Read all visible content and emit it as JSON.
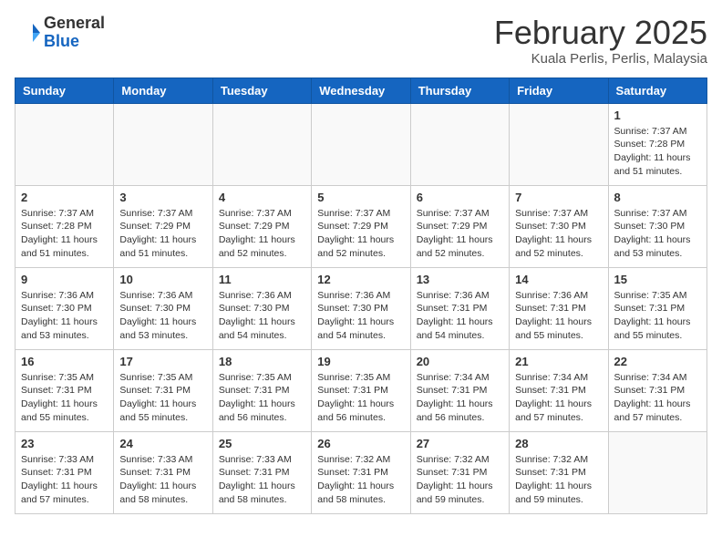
{
  "header": {
    "logo_general": "General",
    "logo_blue": "Blue",
    "month_year": "February 2025",
    "location": "Kuala Perlis, Perlis, Malaysia"
  },
  "weekdays": [
    "Sunday",
    "Monday",
    "Tuesday",
    "Wednesday",
    "Thursday",
    "Friday",
    "Saturday"
  ],
  "weeks": [
    [
      {
        "day": "",
        "sunrise": "",
        "sunset": "",
        "daylight": "",
        "empty": true
      },
      {
        "day": "",
        "sunrise": "",
        "sunset": "",
        "daylight": "",
        "empty": true
      },
      {
        "day": "",
        "sunrise": "",
        "sunset": "",
        "daylight": "",
        "empty": true
      },
      {
        "day": "",
        "sunrise": "",
        "sunset": "",
        "daylight": "",
        "empty": true
      },
      {
        "day": "",
        "sunrise": "",
        "sunset": "",
        "daylight": "",
        "empty": true
      },
      {
        "day": "",
        "sunrise": "",
        "sunset": "",
        "daylight": "",
        "empty": true
      },
      {
        "day": "1",
        "sunrise": "Sunrise: 7:37 AM",
        "sunset": "Sunset: 7:28 PM",
        "daylight": "Daylight: 11 hours and 51 minutes.",
        "empty": false
      }
    ],
    [
      {
        "day": "2",
        "sunrise": "Sunrise: 7:37 AM",
        "sunset": "Sunset: 7:28 PM",
        "daylight": "Daylight: 11 hours and 51 minutes.",
        "empty": false
      },
      {
        "day": "3",
        "sunrise": "Sunrise: 7:37 AM",
        "sunset": "Sunset: 7:29 PM",
        "daylight": "Daylight: 11 hours and 51 minutes.",
        "empty": false
      },
      {
        "day": "4",
        "sunrise": "Sunrise: 7:37 AM",
        "sunset": "Sunset: 7:29 PM",
        "daylight": "Daylight: 11 hours and 52 minutes.",
        "empty": false
      },
      {
        "day": "5",
        "sunrise": "Sunrise: 7:37 AM",
        "sunset": "Sunset: 7:29 PM",
        "daylight": "Daylight: 11 hours and 52 minutes.",
        "empty": false
      },
      {
        "day": "6",
        "sunrise": "Sunrise: 7:37 AM",
        "sunset": "Sunset: 7:29 PM",
        "daylight": "Daylight: 11 hours and 52 minutes.",
        "empty": false
      },
      {
        "day": "7",
        "sunrise": "Sunrise: 7:37 AM",
        "sunset": "Sunset: 7:30 PM",
        "daylight": "Daylight: 11 hours and 52 minutes.",
        "empty": false
      },
      {
        "day": "8",
        "sunrise": "Sunrise: 7:37 AM",
        "sunset": "Sunset: 7:30 PM",
        "daylight": "Daylight: 11 hours and 53 minutes.",
        "empty": false
      }
    ],
    [
      {
        "day": "9",
        "sunrise": "Sunrise: 7:36 AM",
        "sunset": "Sunset: 7:30 PM",
        "daylight": "Daylight: 11 hours and 53 minutes.",
        "empty": false
      },
      {
        "day": "10",
        "sunrise": "Sunrise: 7:36 AM",
        "sunset": "Sunset: 7:30 PM",
        "daylight": "Daylight: 11 hours and 53 minutes.",
        "empty": false
      },
      {
        "day": "11",
        "sunrise": "Sunrise: 7:36 AM",
        "sunset": "Sunset: 7:30 PM",
        "daylight": "Daylight: 11 hours and 54 minutes.",
        "empty": false
      },
      {
        "day": "12",
        "sunrise": "Sunrise: 7:36 AM",
        "sunset": "Sunset: 7:30 PM",
        "daylight": "Daylight: 11 hours and 54 minutes.",
        "empty": false
      },
      {
        "day": "13",
        "sunrise": "Sunrise: 7:36 AM",
        "sunset": "Sunset: 7:31 PM",
        "daylight": "Daylight: 11 hours and 54 minutes.",
        "empty": false
      },
      {
        "day": "14",
        "sunrise": "Sunrise: 7:36 AM",
        "sunset": "Sunset: 7:31 PM",
        "daylight": "Daylight: 11 hours and 55 minutes.",
        "empty": false
      },
      {
        "day": "15",
        "sunrise": "Sunrise: 7:35 AM",
        "sunset": "Sunset: 7:31 PM",
        "daylight": "Daylight: 11 hours and 55 minutes.",
        "empty": false
      }
    ],
    [
      {
        "day": "16",
        "sunrise": "Sunrise: 7:35 AM",
        "sunset": "Sunset: 7:31 PM",
        "daylight": "Daylight: 11 hours and 55 minutes.",
        "empty": false
      },
      {
        "day": "17",
        "sunrise": "Sunrise: 7:35 AM",
        "sunset": "Sunset: 7:31 PM",
        "daylight": "Daylight: 11 hours and 55 minutes.",
        "empty": false
      },
      {
        "day": "18",
        "sunrise": "Sunrise: 7:35 AM",
        "sunset": "Sunset: 7:31 PM",
        "daylight": "Daylight: 11 hours and 56 minutes.",
        "empty": false
      },
      {
        "day": "19",
        "sunrise": "Sunrise: 7:35 AM",
        "sunset": "Sunset: 7:31 PM",
        "daylight": "Daylight: 11 hours and 56 minutes.",
        "empty": false
      },
      {
        "day": "20",
        "sunrise": "Sunrise: 7:34 AM",
        "sunset": "Sunset: 7:31 PM",
        "daylight": "Daylight: 11 hours and 56 minutes.",
        "empty": false
      },
      {
        "day": "21",
        "sunrise": "Sunrise: 7:34 AM",
        "sunset": "Sunset: 7:31 PM",
        "daylight": "Daylight: 11 hours and 57 minutes.",
        "empty": false
      },
      {
        "day": "22",
        "sunrise": "Sunrise: 7:34 AM",
        "sunset": "Sunset: 7:31 PM",
        "daylight": "Daylight: 11 hours and 57 minutes.",
        "empty": false
      }
    ],
    [
      {
        "day": "23",
        "sunrise": "Sunrise: 7:33 AM",
        "sunset": "Sunset: 7:31 PM",
        "daylight": "Daylight: 11 hours and 57 minutes.",
        "empty": false
      },
      {
        "day": "24",
        "sunrise": "Sunrise: 7:33 AM",
        "sunset": "Sunset: 7:31 PM",
        "daylight": "Daylight: 11 hours and 58 minutes.",
        "empty": false
      },
      {
        "day": "25",
        "sunrise": "Sunrise: 7:33 AM",
        "sunset": "Sunset: 7:31 PM",
        "daylight": "Daylight: 11 hours and 58 minutes.",
        "empty": false
      },
      {
        "day": "26",
        "sunrise": "Sunrise: 7:32 AM",
        "sunset": "Sunset: 7:31 PM",
        "daylight": "Daylight: 11 hours and 58 minutes.",
        "empty": false
      },
      {
        "day": "27",
        "sunrise": "Sunrise: 7:32 AM",
        "sunset": "Sunset: 7:31 PM",
        "daylight": "Daylight: 11 hours and 59 minutes.",
        "empty": false
      },
      {
        "day": "28",
        "sunrise": "Sunrise: 7:32 AM",
        "sunset": "Sunset: 7:31 PM",
        "daylight": "Daylight: 11 hours and 59 minutes.",
        "empty": false
      },
      {
        "day": "",
        "sunrise": "",
        "sunset": "",
        "daylight": "",
        "empty": true
      }
    ]
  ]
}
